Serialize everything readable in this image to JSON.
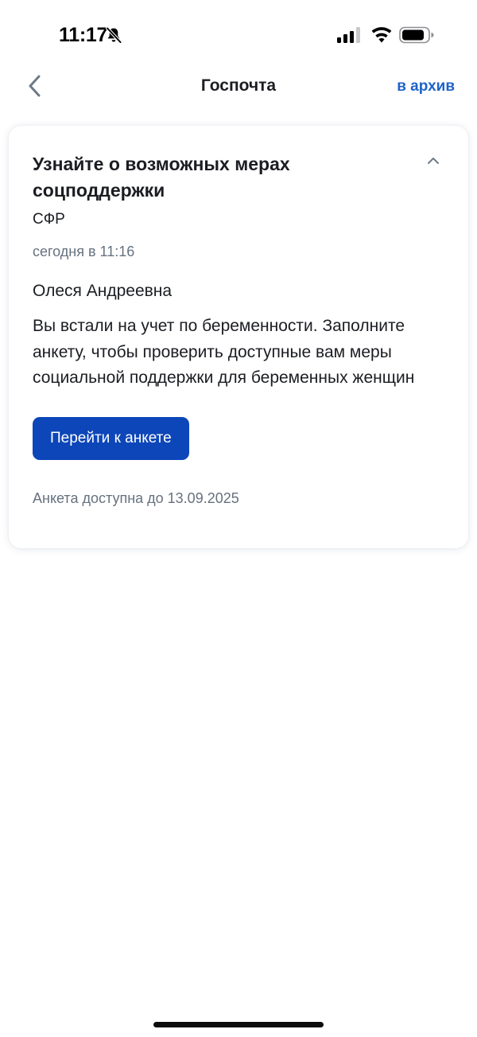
{
  "status_bar": {
    "time": "11:17",
    "icons": [
      "bell-slash-icon",
      "cellular-signal-icon",
      "wifi-icon",
      "battery-icon"
    ]
  },
  "nav": {
    "title": "Госпочта",
    "archive_label": "в архив",
    "back_icon": "chevron-left-icon"
  },
  "message": {
    "title": "Узнайте о возможных мерах соцподдержки",
    "sender": "СФР",
    "timestamp": "сегодня в 11:16",
    "greeting": "Олеся Андреевна",
    "body": "Вы встали на учет по беременности. Заполните анкету, чтобы проверить доступные вам меры социальной поддержки для беременных женщин",
    "cta_label": "Перейти к анкете",
    "availability": "Анкета доступна до 13.09.2025",
    "collapse_icon": "chevron-up-icon"
  },
  "colors": {
    "accent": "#1d63c7",
    "button": "#0d46b8",
    "muted_text": "#66727f",
    "text": "#1b1d22"
  }
}
